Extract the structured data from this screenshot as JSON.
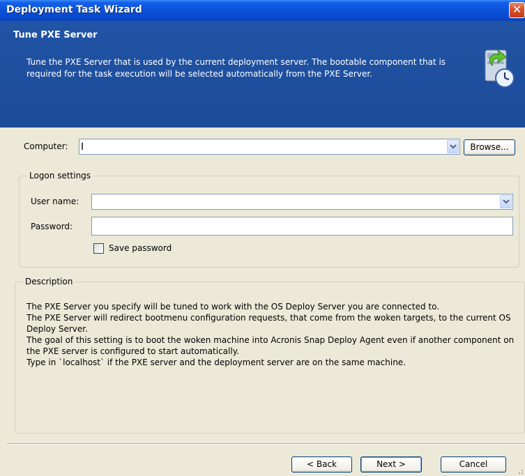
{
  "window": {
    "title": "Deployment Task Wizard",
    "close_glyph": "✕"
  },
  "header": {
    "title": "Tune PXE Server",
    "description": "Tune the PXE Server that is used by the current deployment server. The bootable component that is required for the task execution will be selected automatically from the PXE Server.",
    "icon": "server-clock-icon"
  },
  "computer": {
    "label": "Computer:",
    "value": "",
    "browse_label": "Browse..."
  },
  "logon": {
    "legend": "Logon settings",
    "username_label": "User name:",
    "username_value": "",
    "password_label": "Password:",
    "password_value": "",
    "save_password_label": "Save password",
    "save_password_checked": false
  },
  "description": {
    "legend": "Description",
    "text": "The PXE Server you specify will be tuned to work with the OS Deploy Server you are connected to.\nThe PXE Server will redirect bootmenu configuration requests, that come from the woken targets, to the current OS Deploy Server.\nThe goal of this setting is to boot the woken machine into Acronis Snap Deploy Agent even if another component on the PXE server is configured to start automatically.\nType in `localhost` if the PXE server and the deployment server are on the same machine."
  },
  "buttons": {
    "back_label": "< Back",
    "next_label": "Next >",
    "cancel_label": "Cancel"
  },
  "colors": {
    "header_bg": "#1e4e9c",
    "titlebar": "#0a4fd8",
    "dialog_bg": "#ece9d8"
  }
}
